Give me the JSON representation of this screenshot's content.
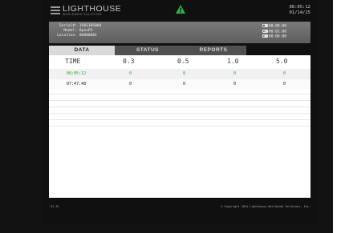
{
  "brand": {
    "name": "LIGHTHOUSE",
    "tagline": "WORLDWIDE SOLUTIONS"
  },
  "status": {
    "icon": "warning-triangle-icon",
    "color": "#2fb04a"
  },
  "clock": {
    "time": "08:05:12",
    "date": "01/14/15"
  },
  "device_info": {
    "serial_label": "Serial#:",
    "serial_value": "1501105004",
    "model_label": "Model:",
    "model_value": "ApexP3",
    "location_label": "Location:",
    "location_value": "00000001"
  },
  "timers": [
    {
      "icon": "clock-icon",
      "value": "00:00:00"
    },
    {
      "icon": "hold-icon",
      "value": "00:01:00"
    },
    {
      "icon": "cycle-icon",
      "value": "00:00:00"
    }
  ],
  "tabs": [
    {
      "label": "DATA",
      "active": true
    },
    {
      "label": "STATUS",
      "active": false
    },
    {
      "label": "REPORTS",
      "active": false
    }
  ],
  "table": {
    "columns": [
      "TIME",
      "0.3",
      "0.5",
      "1.0",
      "5.0"
    ],
    "rows": [
      [
        "08:05:12",
        "0",
        "0",
        "0",
        "0"
      ],
      [
        "07:47:48",
        "0",
        "0",
        "0",
        "0"
      ]
    ]
  },
  "footer": {
    "version": "01.33",
    "copyright": "© Copyright 2014 Lighthouse Worldwide Solutions, Inc."
  }
}
